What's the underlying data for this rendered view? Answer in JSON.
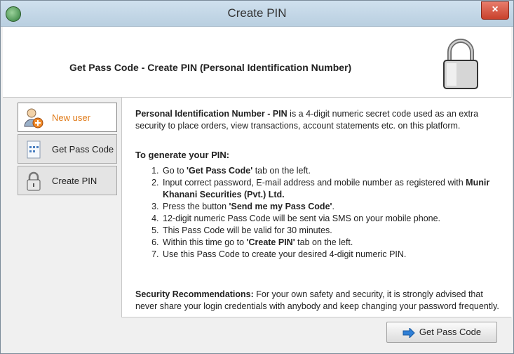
{
  "window": {
    "title": "Create PIN",
    "close_glyph": "×"
  },
  "header": {
    "title": "Get Pass Code - Create PIN (Personal Identification Number)",
    "icon": "padlock-icon"
  },
  "sidebar": {
    "items": [
      {
        "label": "New user",
        "icon": "user-add-icon",
        "active": true
      },
      {
        "label": "Get Pass Code",
        "icon": "passcode-icon",
        "active": false
      },
      {
        "label": "Create PIN",
        "icon": "lock-small-icon",
        "active": false
      }
    ]
  },
  "content": {
    "intro_bold": "Personal Identification Number - PIN",
    "intro_rest": " is a 4-digit numeric secret code used as an extra security to place orders, view transactions, account statements etc. on this platform.",
    "subhead": "To generate your PIN:",
    "steps": [
      {
        "pre": "Go to ",
        "bold": "'Get Pass Code'",
        "post": " tab on the left."
      },
      {
        "pre": "Input correct password, E-mail address and mobile number as registered with ",
        "bold": "Munir Khanani Securities (Pvt.) Ltd.",
        "post": ""
      },
      {
        "pre": "Press the button ",
        "bold": "'Send me my Pass Code'",
        "post": "."
      },
      {
        "pre": "12-digit numeric Pass Code will be sent via SMS on your mobile phone.",
        "bold": "",
        "post": ""
      },
      {
        "pre": "This Pass Code will be valid for 30 minutes.",
        "bold": "",
        "post": ""
      },
      {
        "pre": "Within this time go to ",
        "bold": "'Create PIN'",
        "post": " tab on the left."
      },
      {
        "pre": "Use this Pass Code to create your desired 4-digit numeric PIN.",
        "bold": "",
        "post": ""
      }
    ],
    "security_bold": "Security Recommendations:",
    "security_rest": " For your own safety and security, it is strongly advised that never share your login credentials with anybody and keep changing your password frequently."
  },
  "footer": {
    "button_label": "Get Pass Code",
    "button_icon": "arrow-right-icon"
  },
  "colors": {
    "titlebar": "#c4d7e7",
    "close": "#d9533f",
    "active_label": "#e07b1a",
    "arrow": "#2f7fd6"
  }
}
